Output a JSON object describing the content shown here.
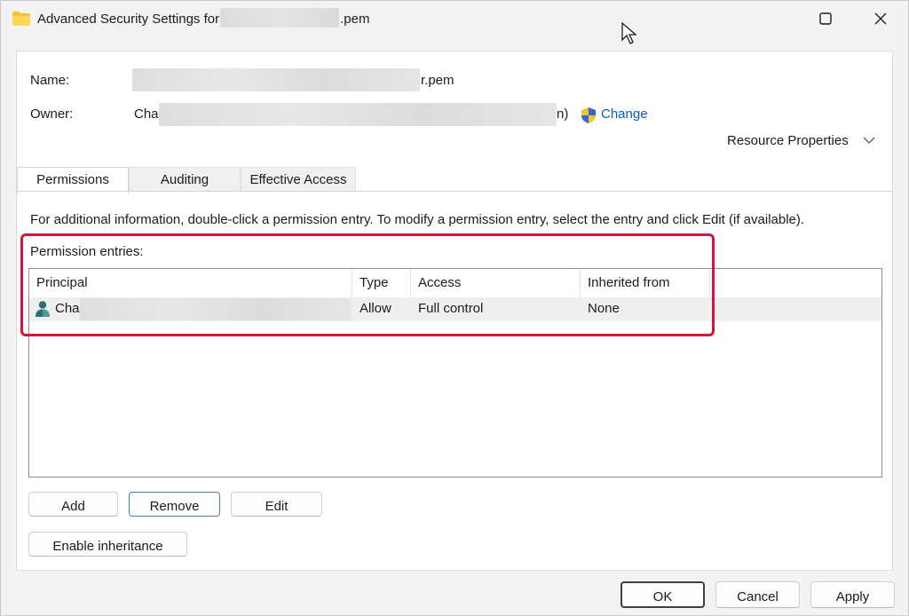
{
  "window": {
    "title_prefix": "Advanced Security Settings for",
    "title_suffix": ".pem",
    "min_glyph": "—",
    "max_glyph": "☐",
    "close_glyph": "✕"
  },
  "header": {
    "name_label": "Name:",
    "name_suffix": "r.pem",
    "owner_label": "Owner:",
    "owner_prefix": "Cha",
    "owner_suffix": "n)",
    "change_link": "Change",
    "resource_properties": "Resource Properties"
  },
  "tabs": [
    {
      "label": "Permissions",
      "active": true
    },
    {
      "label": "Auditing",
      "active": false
    },
    {
      "label": "Effective Access",
      "active": false
    }
  ],
  "info_text": "For additional information, double-click a permission entry. To modify a permission entry, select the entry and click Edit (if available).",
  "entries_label": "Permission entries:",
  "table": {
    "columns": [
      "Principal",
      "Type",
      "Access",
      "Inherited from"
    ],
    "rows": [
      {
        "principal_prefix": "Cha",
        "type": "Allow",
        "access": "Full control",
        "inherited": "None"
      }
    ]
  },
  "buttons": {
    "add": "Add",
    "remove": "Remove",
    "edit": "Edit",
    "enable_inheritance": "Enable inheritance",
    "ok": "OK",
    "cancel": "Cancel",
    "apply": "Apply"
  },
  "colors": {
    "link": "#0a5cc2",
    "highlight": "#d4143a"
  }
}
